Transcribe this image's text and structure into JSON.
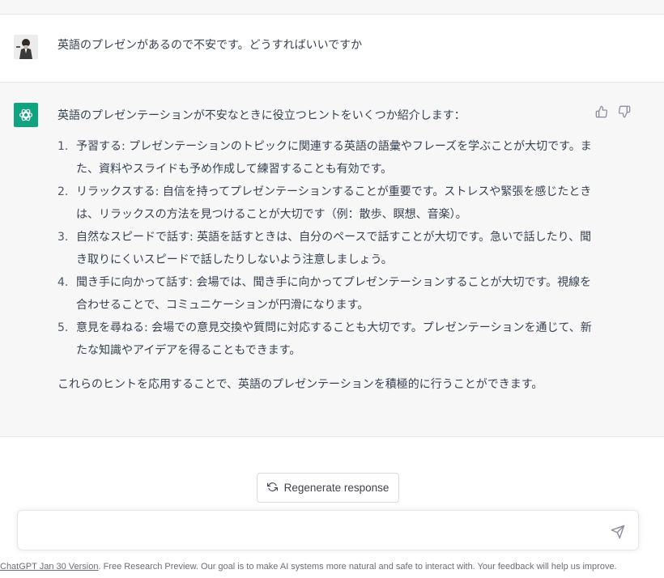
{
  "conversation": {
    "user_message": "英語のプレゼンがあるので不安です。どうすればいいですか",
    "assistant": {
      "intro": "英語のプレゼンテーションが不安なときに役立つヒントをいくつか紹介します：",
      "items": [
        {
          "num": "1.",
          "text": "予習する: プレゼンテーションのトピックに関連する英語の語彙やフレーズを学ぶことが大切です。また、資料やスライドも予め作成して練習することも有効です。"
        },
        {
          "num": "2.",
          "text": "リラックスする: 自信を持ってプレゼンテーションすることが重要です。ストレスや緊張を感じたときは、リラックスの方法を見つけることが大切です（例：散歩、瞑想、音楽）。"
        },
        {
          "num": "3.",
          "text": "自然なスピードで話す: 英語を話すときは、自分のペースで話すことが大切です。急いで話したり、聞き取りにくいスピードで話したりしないよう注意しましょう。"
        },
        {
          "num": "4.",
          "text": "聞き手に向かって話す: 会場では、聞き手に向かってプレゼンテーションすることが大切です。視線を合わせることで、コミュニケーションが円滑になります。"
        },
        {
          "num": "5.",
          "text": "意見を尋ねる: 会場での意見交換や質問に対応することも大切です。プレゼンテーションを通じて、新たな知識やアイデアを得ることもできます。"
        }
      ],
      "outro": "これらのヒントを応用することで、英語のプレゼンテーションを積極的に行うことができます。"
    }
  },
  "controls": {
    "regenerate_label": "Regenerate response",
    "composer_value": "",
    "composer_placeholder": ""
  },
  "footer": {
    "version_link": "ChatGPT Jan 30 Version",
    "text": ". Free Research Preview. Our goal is to make AI systems more natural and safe to interact with. Your feedback will help us improve."
  },
  "icons": {
    "bot_avatar": "openai-logo-icon",
    "thumbs_up": "thumbs-up-icon",
    "thumbs_down": "thumbs-down-icon",
    "regenerate": "refresh-icon",
    "send": "send-icon"
  },
  "colors": {
    "bot_avatar_bg": "#10a37f",
    "assistant_bg": "#f7f7f8"
  }
}
